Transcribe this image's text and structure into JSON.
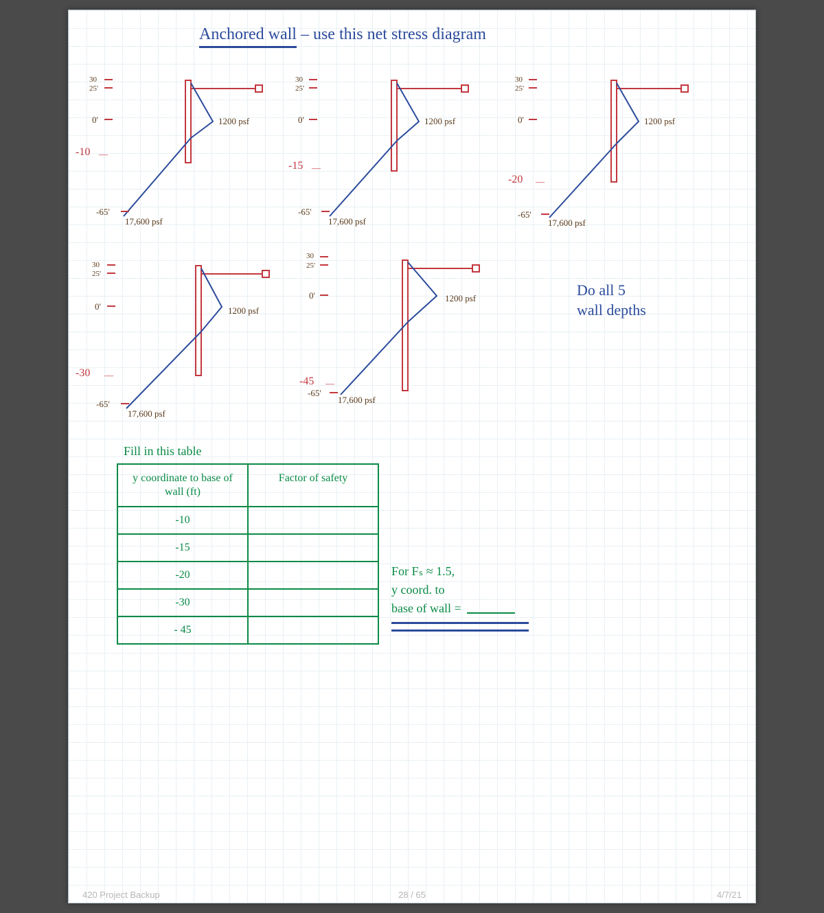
{
  "title_part1": "Anchored wall",
  "title_part2": " – use this   net stress   diagram",
  "diagrams": [
    {
      "embed": "-10"
    },
    {
      "embed": "-15"
    },
    {
      "embed": "-20"
    },
    {
      "embed": "-30"
    },
    {
      "embed": "-45",
      "short_bottom": true
    }
  ],
  "common": {
    "tick_30": "30",
    "tick_25": "25'",
    "tick_0": "0'",
    "tick_neg65": "-65'",
    "load_top": "1200 psf",
    "load_bottom": "17,600 psf"
  },
  "side_note_l1": "Do  all   5",
  "side_note_l2": "wall  depths",
  "table_caption": "Fill in this table",
  "table": {
    "col1_header": "y coordinate to base of wall (ft)",
    "col2_header": "Factor of safety",
    "rows": [
      "-10",
      "-15",
      "-20",
      "-30",
      "- 45"
    ]
  },
  "answer": {
    "line1": "For  Fₛ ≈ 1.5,",
    "line2": "y coord. to",
    "line3": "base of wall  ="
  },
  "footer": {
    "left": "420 Project Backup",
    "center": "28 / 65",
    "right": "4/7/21"
  }
}
